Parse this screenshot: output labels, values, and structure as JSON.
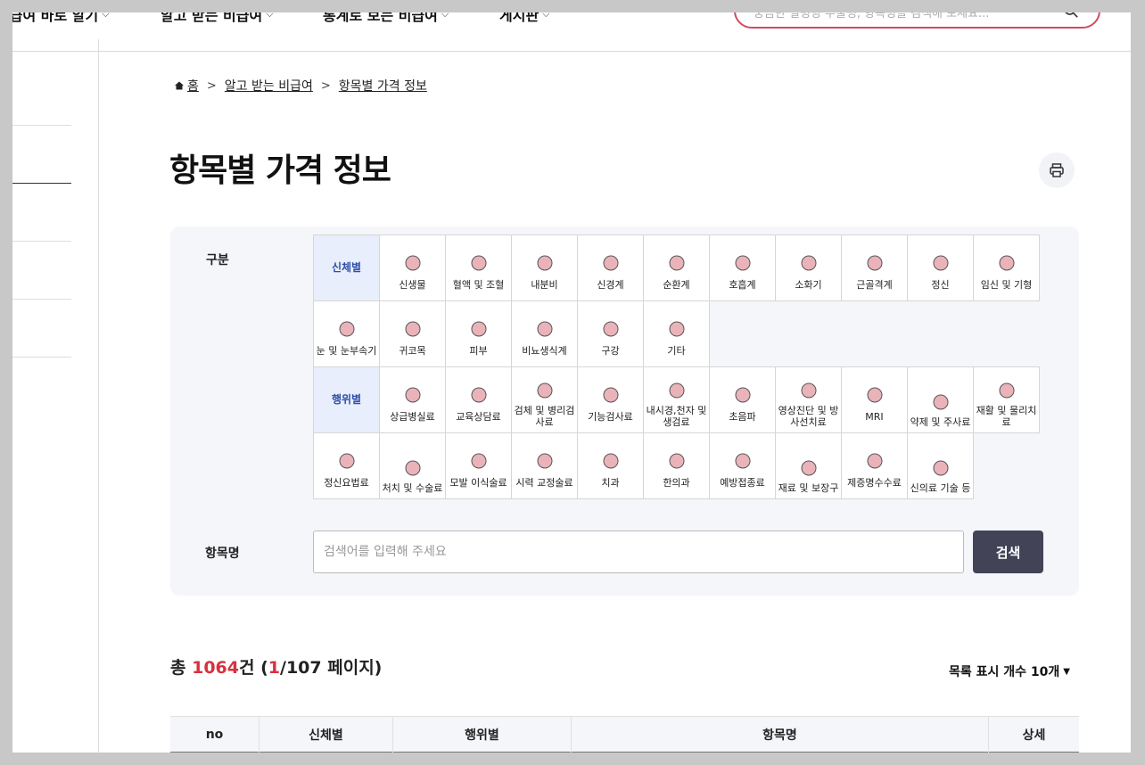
{
  "nav": {
    "items": [
      {
        "label": "비급여 바로 알기"
      },
      {
        "label": "알고 받는 비급여"
      },
      {
        "label": "통계로 보는 비급여"
      },
      {
        "label": "게시판"
      }
    ],
    "search_placeholder": "궁금한 질병명 수술명, 항목명을 검색해 보세요..."
  },
  "breadcrumb": {
    "home": "홈",
    "level1": "알고 받는 비급여",
    "current": "항목별 가격 정보"
  },
  "page_title": "항목별 가격 정보",
  "filter": {
    "category_label": "구분",
    "body_group": "신체별",
    "body_items": [
      {
        "label": "신생물",
        "icon": "tumor-icon"
      },
      {
        "label": "혈액 및 조혈",
        "icon": "blood-cell-icon"
      },
      {
        "label": "내분비",
        "icon": "pelvis-icon"
      },
      {
        "label": "신경계",
        "icon": "nerve-icon"
      },
      {
        "label": "순환계",
        "icon": "heart-icon"
      },
      {
        "label": "호흡계",
        "icon": "lungs-icon"
      },
      {
        "label": "소화기",
        "icon": "stomach-icon"
      },
      {
        "label": "근골격계",
        "icon": "bone-icon"
      },
      {
        "label": "정신",
        "icon": "brain-icon"
      },
      {
        "label": "임신 및 기형",
        "icon": "uterus-icon"
      },
      {
        "label": "눈 및 눈부속기",
        "icon": "eye-icon"
      },
      {
        "label": "귀코목",
        "icon": "head-profile-icon"
      },
      {
        "label": "피부",
        "icon": "face-skin-icon"
      },
      {
        "label": "비뇨생식계",
        "icon": "gender-icon"
      },
      {
        "label": "구강",
        "icon": "tooth-icon"
      },
      {
        "label": "기타",
        "icon": "stethoscope-icon"
      }
    ],
    "action_group": "행위별",
    "action_items": [
      {
        "label": "상급병실료",
        "icon": "hospital-bed-icon"
      },
      {
        "label": "교육상담료",
        "icon": "consultation-icon"
      },
      {
        "label": "검체 및 병리검사료",
        "icon": "test-tubes-icon"
      },
      {
        "label": "기능검사료",
        "icon": "clipboard-stethoscope-icon"
      },
      {
        "label": "내시경,천자 및 생검료",
        "icon": "endoscope-icon"
      },
      {
        "label": "초음파",
        "icon": "ultrasound-icon"
      },
      {
        "label": "영상진단 및 방사선치료",
        "icon": "ct-scanner-icon"
      },
      {
        "label": "MRI",
        "icon": "mri-icon"
      },
      {
        "label": "약제 및 주사료",
        "icon": "syringe-icon"
      },
      {
        "label": "재활 및 물리치료",
        "icon": "physiotherapy-icon"
      },
      {
        "label": "정신요법료",
        "icon": "brain-outline-icon"
      },
      {
        "label": "처치 및 수술료",
        "icon": "scalpel-icon"
      },
      {
        "label": "모발 이식술료",
        "icon": "hair-icon"
      },
      {
        "label": "시력 교정술료",
        "icon": "eye-laser-icon"
      },
      {
        "label": "치과",
        "icon": "teeth-icon"
      },
      {
        "label": "한의과",
        "icon": "acupuncture-icon"
      },
      {
        "label": "예방접종료",
        "icon": "vaccine-icon"
      },
      {
        "label": "재료 및 보장구",
        "icon": "medicine-bottles-icon"
      },
      {
        "label": "제증명수수료",
        "icon": "certificate-icon"
      },
      {
        "label": "신의료 기술 등",
        "icon": "medical-kit-icon"
      }
    ],
    "item_label": "항목명",
    "item_placeholder": "검색어를 입력해 주세요",
    "search_button": "검색"
  },
  "results": {
    "prefix": "총 ",
    "count": "1064",
    "unit": "건 (",
    "page": "1",
    "pages_suffix": "/107 페이지)",
    "per_page_label": "목록 표시 개수 10개"
  },
  "table": {
    "columns": [
      "no",
      "신체별",
      "행위별",
      "항목명",
      "상세"
    ]
  },
  "colors": {
    "accent_red": "#d9303e",
    "search_border": "#d34a5c",
    "button_dark": "#424357",
    "category_bg": "#e8eefb",
    "category_text": "#2f4fa8"
  }
}
